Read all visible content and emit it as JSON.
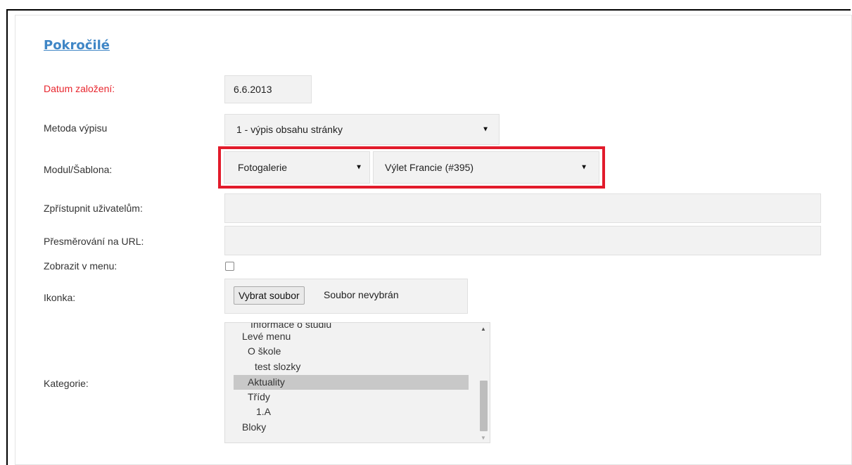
{
  "section": {
    "title": "Pokročilé"
  },
  "fields": {
    "created_label": "Datum založení:",
    "created_value": "6.6.2013",
    "method_label": "Metoda výpisu",
    "method_value": "1 - výpis obsahu stránky",
    "module_label": "Modul/Šablona:",
    "module_value": "Fotogalerie",
    "template_value": "Výlet Francie (#395)",
    "users_label": "Zpřístupnit uživatelům:",
    "users_value": "",
    "redirect_label": "Přesměrování na URL:",
    "redirect_value": "",
    "menu_label": "Zobrazit v menu:",
    "menu_checked": false,
    "icon_label": "Ikonka:",
    "file_button": "Vybrat soubor",
    "file_status": "Soubor nevybrán",
    "category_label": "Kategorie:"
  },
  "category_list": {
    "items": [
      {
        "label": "Informace o studiu",
        "selected": false
      },
      {
        "label": "Levé menu",
        "selected": false
      },
      {
        "label": "O škole",
        "selected": false
      },
      {
        "label": "test slozky",
        "selected": false
      },
      {
        "label": "Aktuality",
        "selected": true
      },
      {
        "label": "Třídy",
        "selected": false
      },
      {
        "label": "1.A",
        "selected": false
      },
      {
        "label": "Bloky",
        "selected": false
      }
    ]
  },
  "colors": {
    "title_link": "#3f86c6",
    "required_label": "#e8262e",
    "highlight_border": "#e21b2b",
    "field_bg": "#f2f2f2",
    "selected_item_bg": "#c8c8c8"
  },
  "icons": {
    "dropdown": "caret-down-icon",
    "scroll_up": "scroll-up-arrow-icon",
    "scroll_down": "scroll-down-arrow-icon"
  }
}
